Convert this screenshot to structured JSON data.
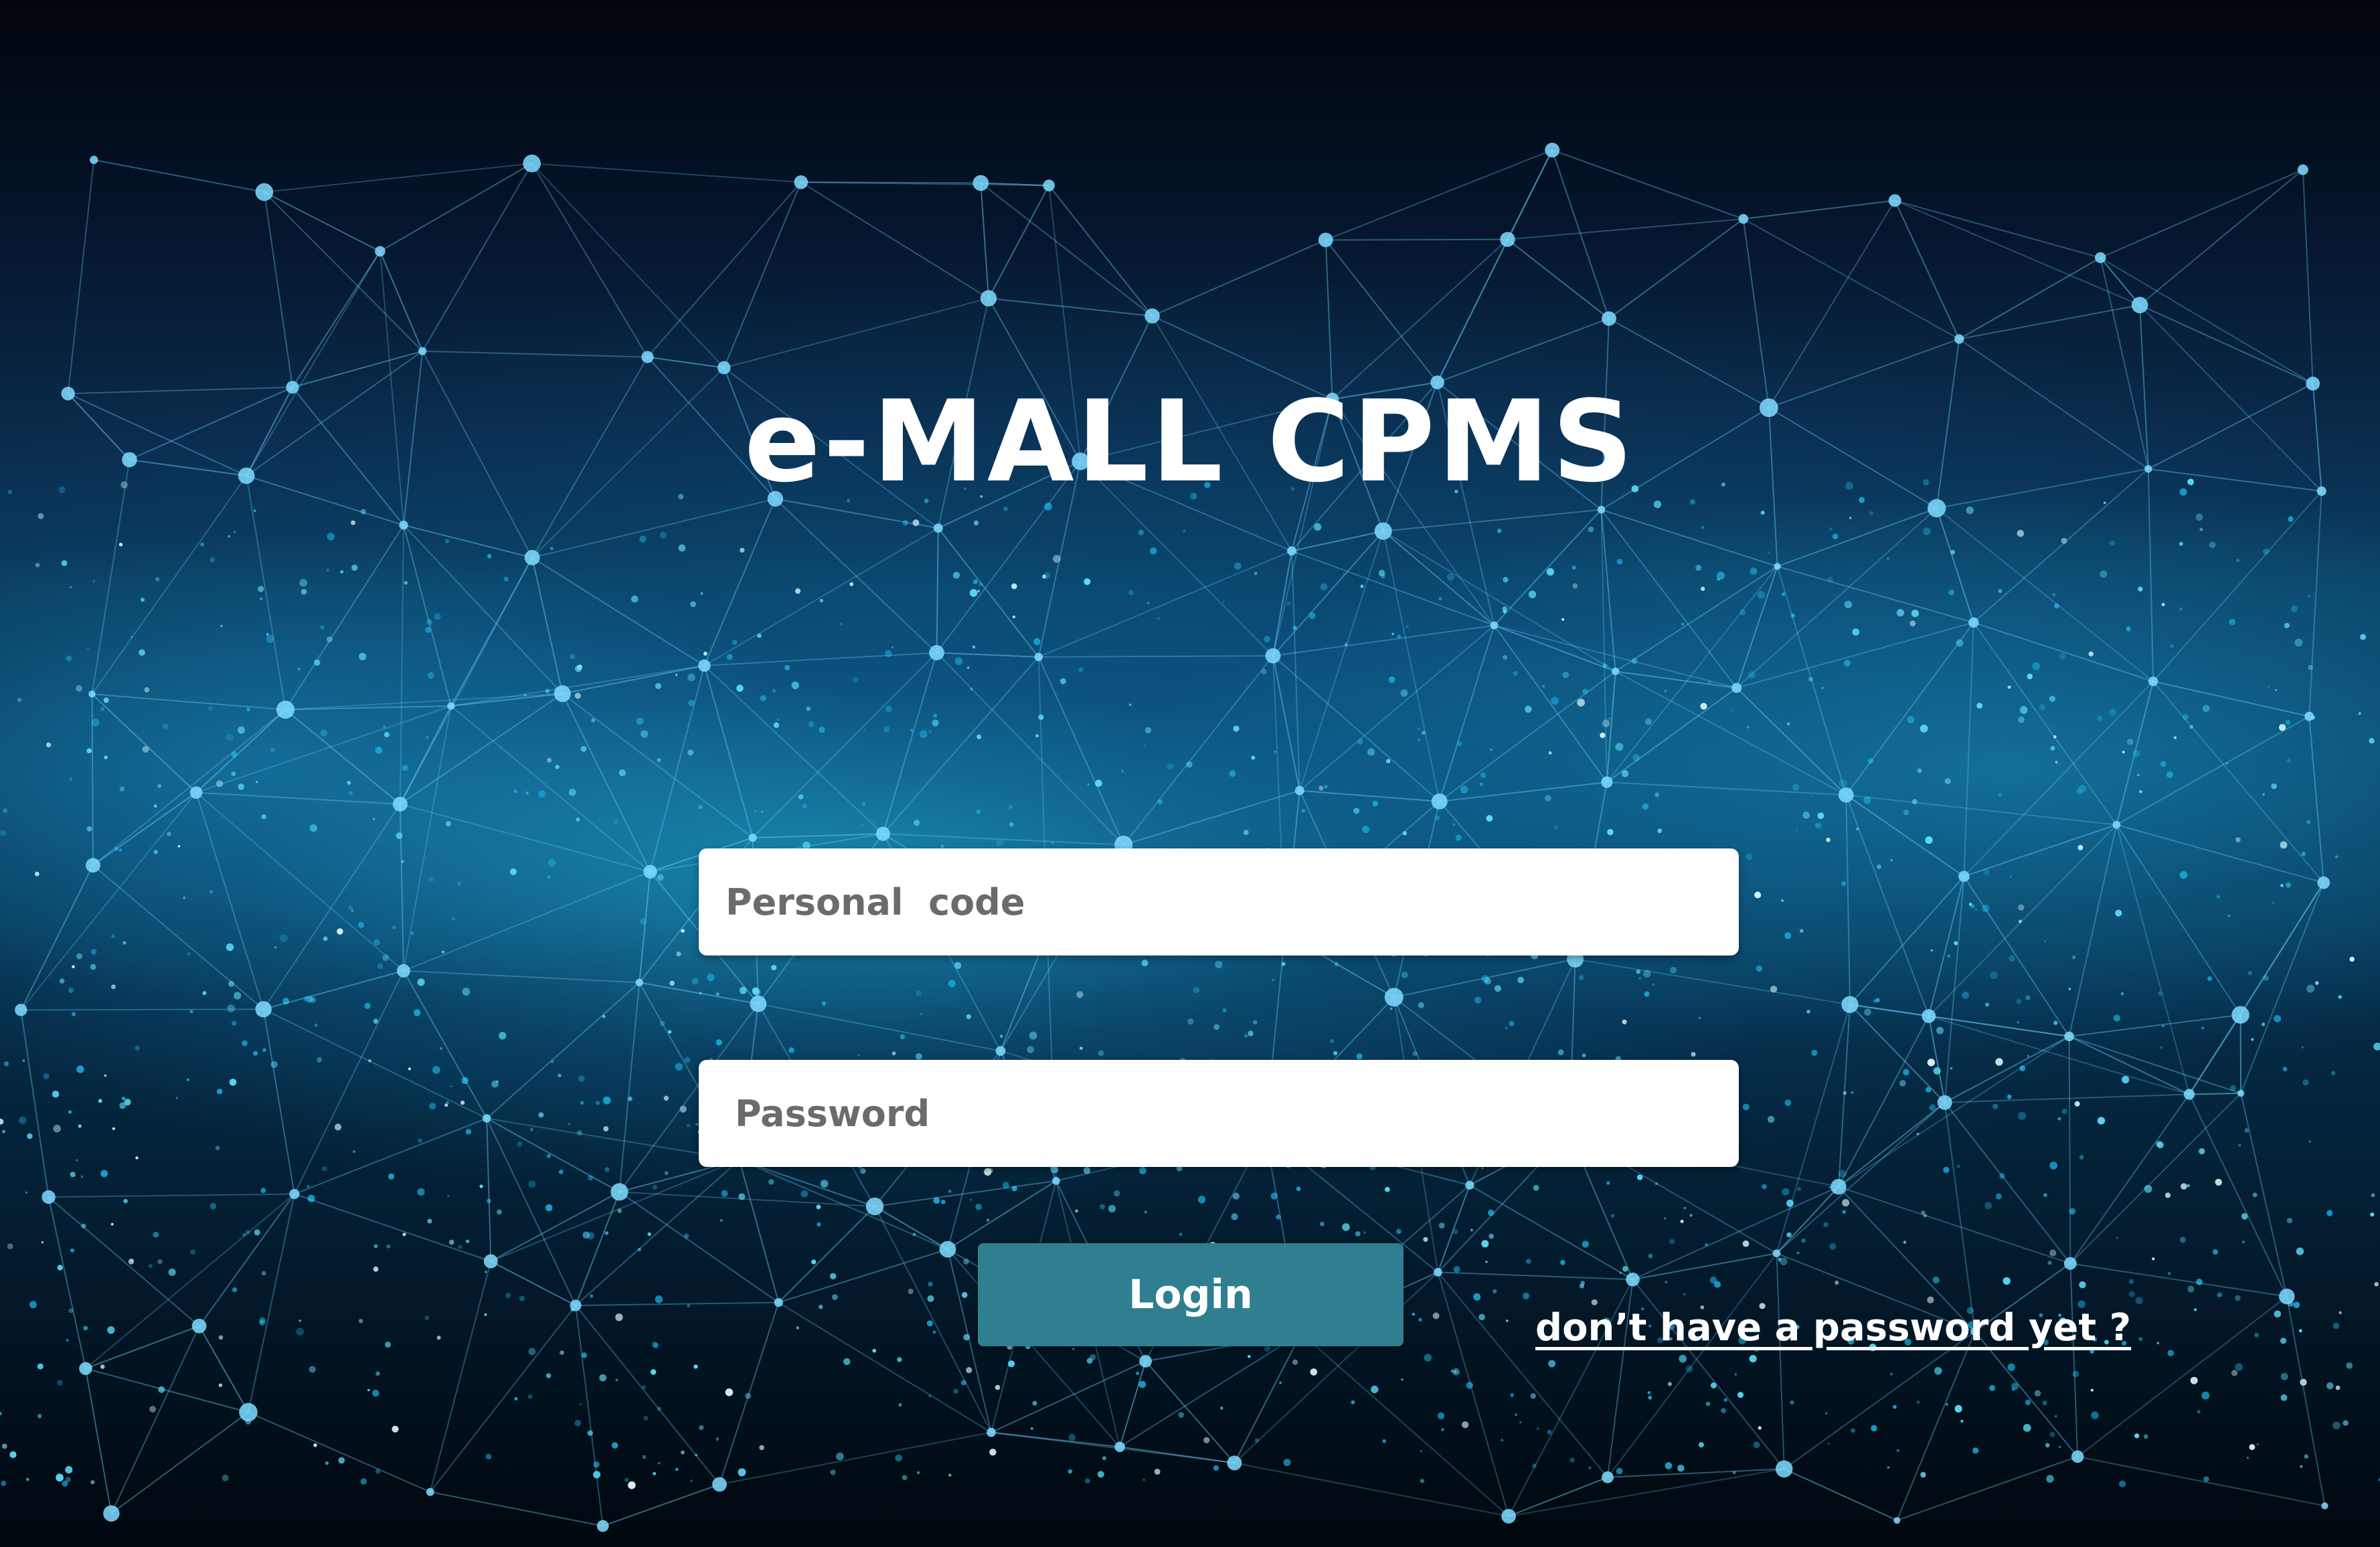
{
  "app": {
    "title": "e-MALL CPMS"
  },
  "form": {
    "personal_code": {
      "placeholder": "Personal  code",
      "value": ""
    },
    "password": {
      "placeholder": "Password",
      "value": ""
    },
    "login_label": "Login",
    "no_password_link": "don’t have a password yet ?"
  },
  "background": {
    "description_icon": "city-network-background",
    "colors": {
      "sky_top": "#02050c",
      "network_line": "#5fc8ff",
      "city_glow": "#28bee6"
    }
  },
  "colors": {
    "button": "#2f7f90",
    "field": "#ffffff",
    "placeholder": "#6b6b6b",
    "text_light": "#ffffff"
  }
}
